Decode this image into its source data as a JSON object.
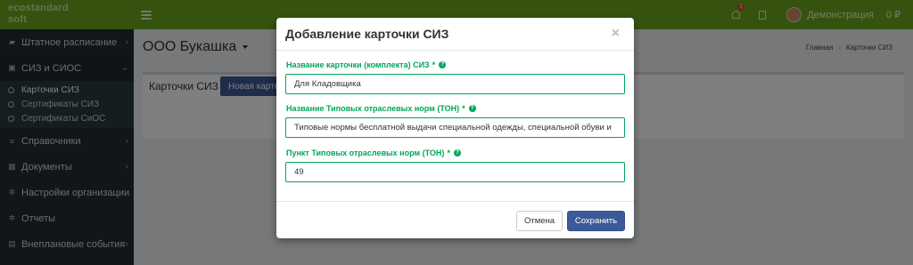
{
  "header": {
    "logo_line1": "ecostandard",
    "logo_line2": "soft",
    "notification_count": "1",
    "user_name": "Демонстрация",
    "balance": "0 ₽"
  },
  "sidebar": {
    "items": [
      {
        "label": "Штатное расписание"
      },
      {
        "label": "СИЗ и СИОС"
      },
      {
        "label": "Справочники"
      },
      {
        "label": "Документы"
      },
      {
        "label": "Настройки организации"
      },
      {
        "label": "Отчеты"
      },
      {
        "label": "Внеплановые события"
      }
    ],
    "sub_items": [
      {
        "label": "Карточки СИЗ"
      },
      {
        "label": "Сертификаты СИЗ"
      },
      {
        "label": "Сертификаты СиОС"
      }
    ]
  },
  "content": {
    "org_name": "ООО Букашка",
    "breadcrumb_home": "Главная",
    "breadcrumb_current": "Карточки СИЗ",
    "panel_title": "Карточки СИЗ",
    "panel_button": "Новая карто"
  },
  "modal": {
    "title": "Добавление карточки СИЗ",
    "close": "×",
    "fields": [
      {
        "label": "Название карточки (комплекта) СИЗ",
        "value": "Для Кладовщика"
      },
      {
        "label": "Название Типовых отраслевых норм (ТОН)",
        "value": "Типовые нормы бесплатной выдачи специальной одежды, специальной обуви и"
      },
      {
        "label": "Пункт Типовых отраслевых норм (ТОН)",
        "value": "49"
      }
    ],
    "required_mark": "*",
    "help_glyph": "?",
    "cancel_label": "Отмена",
    "save_label": "Сохранить"
  },
  "colors": {
    "header_green": "#6aa71c",
    "sidebar_dark": "#222d32",
    "field_green": "#00a65a",
    "primary_blue": "#3c5a99"
  }
}
